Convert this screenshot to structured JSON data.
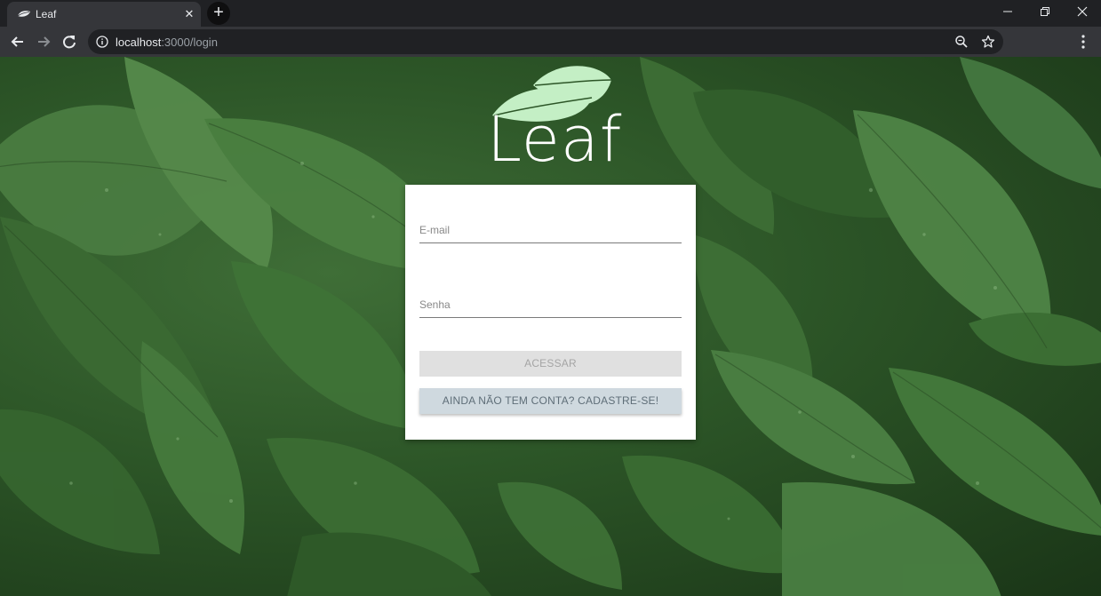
{
  "browser": {
    "tab_title": "Leaf",
    "tab_close": "✕",
    "new_tab": "+",
    "url_host": "localhost",
    "url_path": ":3000/login",
    "icons": {
      "favicon": "leaf-icon",
      "close": "close-icon",
      "back": "back-arrow-icon",
      "forward": "forward-arrow-icon",
      "reload": "reload-icon",
      "info": "info-icon",
      "zoom": "zoom-icon",
      "bookmark": "star-icon",
      "menu": "menu-dots-icon"
    }
  },
  "login": {
    "logo_text": "Leaf",
    "email_placeholder": "E-mail",
    "password_placeholder": "Senha",
    "login_button": "ACESSAR",
    "signup_button": "AINDA NÃO TEM CONTA? CADASTRE-SE!"
  },
  "colors": {
    "logo_leaf": "#c4efc5",
    "card_bg": "#ffffff",
    "login_button_bg": "#e0e0e0",
    "signup_button_bg": "#cfd9df",
    "background_green": "#2c5527"
  }
}
